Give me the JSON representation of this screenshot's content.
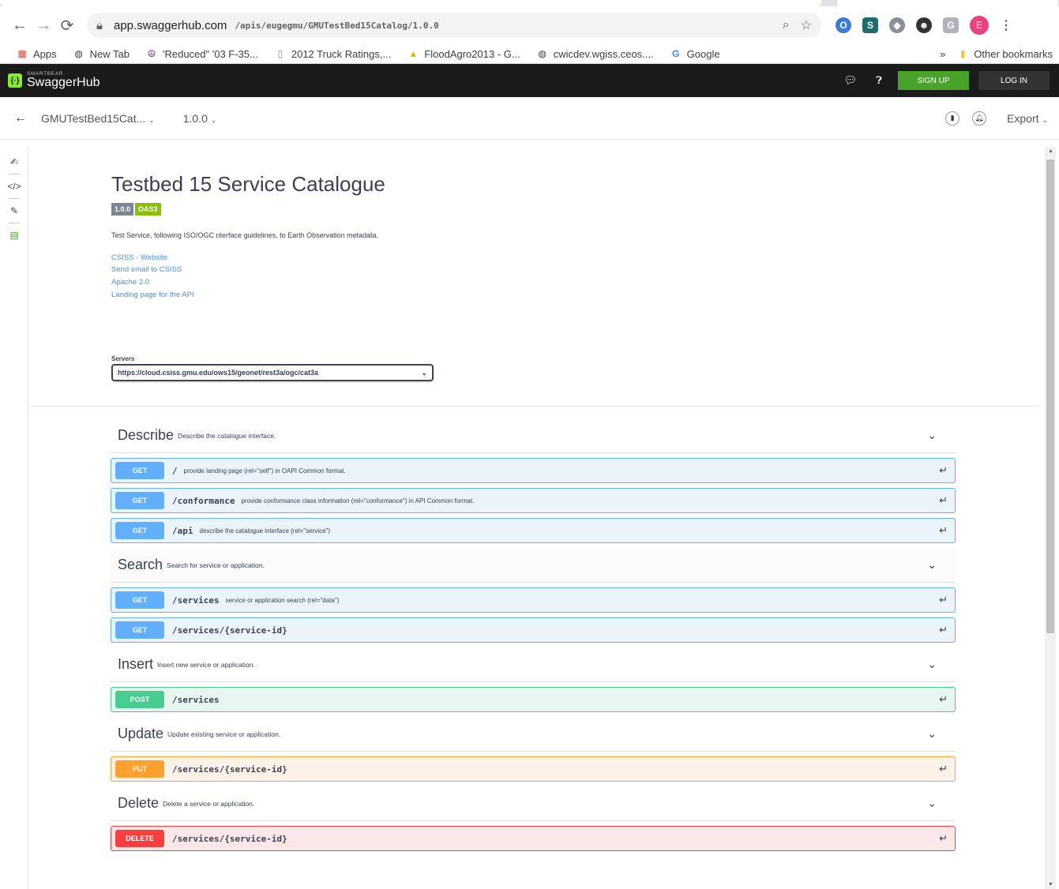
{
  "browser": {
    "url_host": "app.swaggerhub.com",
    "url_path": "/apis/eugegmu/GMUTestBed15Catalog/1.0.0",
    "profile_initial": "E",
    "bookmarks": [
      {
        "label": "Apps"
      },
      {
        "label": "New Tab"
      },
      {
        "label": "'Reduced\" '03 F-35..."
      },
      {
        "label": "2012 Truck Ratings,..."
      },
      {
        "label": "FloodAgro2013 - G..."
      },
      {
        "label": "cwicdev.wgiss.ceos...."
      },
      {
        "label": "Google"
      }
    ],
    "overflow": "»",
    "other_bookmarks": "Other bookmarks"
  },
  "app": {
    "logo_small": "SMARTBEAR",
    "logo_big": "SwaggerHub",
    "signup_label": "SIGN UP",
    "login_label": "LOG IN"
  },
  "subheader": {
    "api_name": "GMUTestBed15Cat...",
    "version": "1.0.0",
    "export_label": "Export"
  },
  "info": {
    "title": "Testbed 15 Service Catalogue",
    "version_badge": "1.0.0",
    "oas_badge": "OAS3",
    "description": "Test Service, following ISO/OGC nterface guidelines, to Earth Observation metadata.",
    "links": [
      "CSISS - Website",
      "Send email to CSISS",
      "Apache 2.0",
      "Landing page for the API"
    ]
  },
  "servers": {
    "label": "Servers",
    "selected": "https://cloud.csiss.gmu.edu/ows15/geonet/rest3a/ogc/cat3a"
  },
  "tags": [
    {
      "name": "Describe",
      "description": "Describe the catalogue interface.",
      "operations": [
        {
          "method": "GET",
          "path": "/",
          "summary": "provide landing page (rel=\"self\") in OAPI Common format."
        },
        {
          "method": "GET",
          "path": "/conformance",
          "summary": "provide conformance class information (rel=\"conformance\") in API Common format."
        },
        {
          "method": "GET",
          "path": "/api",
          "summary": "describe the catalogue interface (rel=\"service\")"
        }
      ]
    },
    {
      "name": "Search",
      "description": "Search for service or application.",
      "operations": [
        {
          "method": "GET",
          "path": "/services",
          "summary": "service or application search (rel=\"data\")"
        },
        {
          "method": "GET",
          "path": "/services/{service-id}",
          "summary": ""
        }
      ]
    },
    {
      "name": "Insert",
      "description": "Insert new service or application.",
      "operations": [
        {
          "method": "POST",
          "path": "/services",
          "summary": ""
        }
      ]
    },
    {
      "name": "Update",
      "description": "Update existing service or application.",
      "operations": [
        {
          "method": "PUT",
          "path": "/services/{service-id}",
          "summary": ""
        }
      ]
    },
    {
      "name": "Delete",
      "description": "Delete a service or application.",
      "operations": [
        {
          "method": "DELETE",
          "path": "/services/{service-id}",
          "summary": ""
        }
      ]
    }
  ],
  "colors": {
    "get": "#61affe",
    "post": "#49cc90",
    "put": "#fca130",
    "delete": "#f93e3e",
    "signup": "#49a32b",
    "oas_badge": "#89bf04"
  }
}
